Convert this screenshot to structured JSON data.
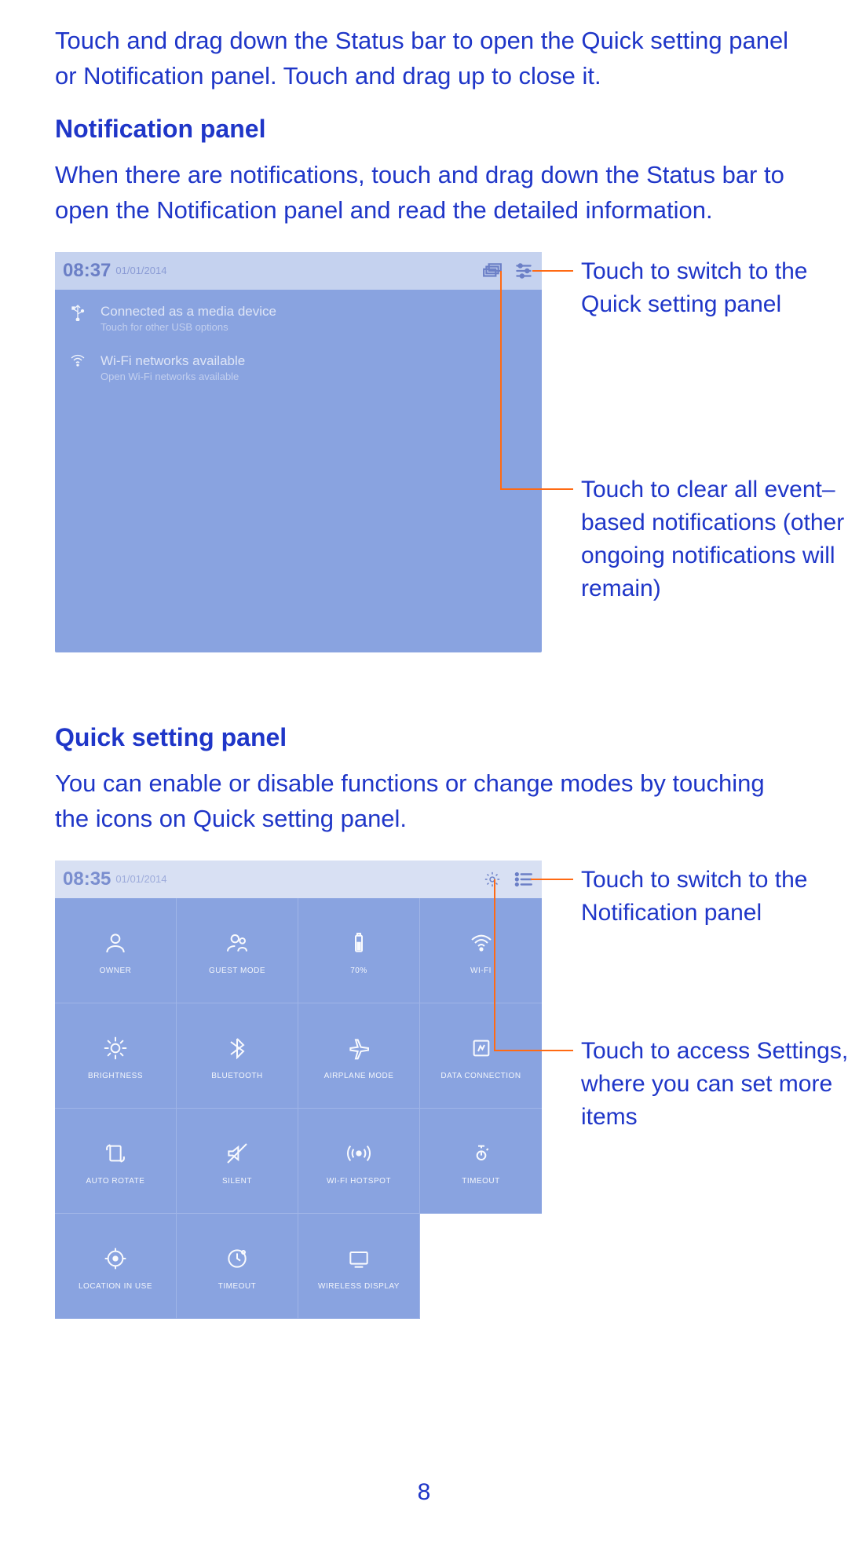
{
  "intro": "Touch and drag down the Status bar to open the Quick setting panel or Notification panel. Touch and drag up to close it.",
  "section1": {
    "heading": "Notification panel",
    "body": "When there are notifications, touch and drag down the Status bar to open the Notification panel and read the detailed information."
  },
  "notif_panel": {
    "time": "08:37",
    "date": "01/01/2014",
    "rows": [
      {
        "title": "Connected as a media device",
        "sub": "Touch for other USB options"
      },
      {
        "title": "Wi-Fi networks available",
        "sub": "Open Wi-Fi networks available"
      }
    ]
  },
  "callouts1": {
    "a": "Touch to switch to the Quick setting panel",
    "b": "Touch to clear all event–based notifications (other ongoing notifications will remain)"
  },
  "section2": {
    "heading": "Quick setting panel",
    "body": "You can enable or disable functions or change modes by touching the icons on Quick setting panel."
  },
  "qs_panel": {
    "time": "08:35",
    "date": "01/01/2014",
    "tiles": [
      "OWNER",
      "GUEST MODE",
      "70%",
      "WI-FI",
      "BRIGHTNESS",
      "BLUETOOTH",
      "AIRPLANE MODE",
      "DATA CONNECTION",
      "AUTO ROTATE",
      "SILENT",
      "WI-FI HOTSPOT",
      "TIMEOUT",
      "LOCATION IN USE",
      "TIMEOUT",
      "WIRELESS DISPLAY",
      ""
    ]
  },
  "callouts2": {
    "a": "Touch to switch to the Notification panel",
    "b": "Touch to access Settings, where you can set more items"
  },
  "page_number": "8"
}
